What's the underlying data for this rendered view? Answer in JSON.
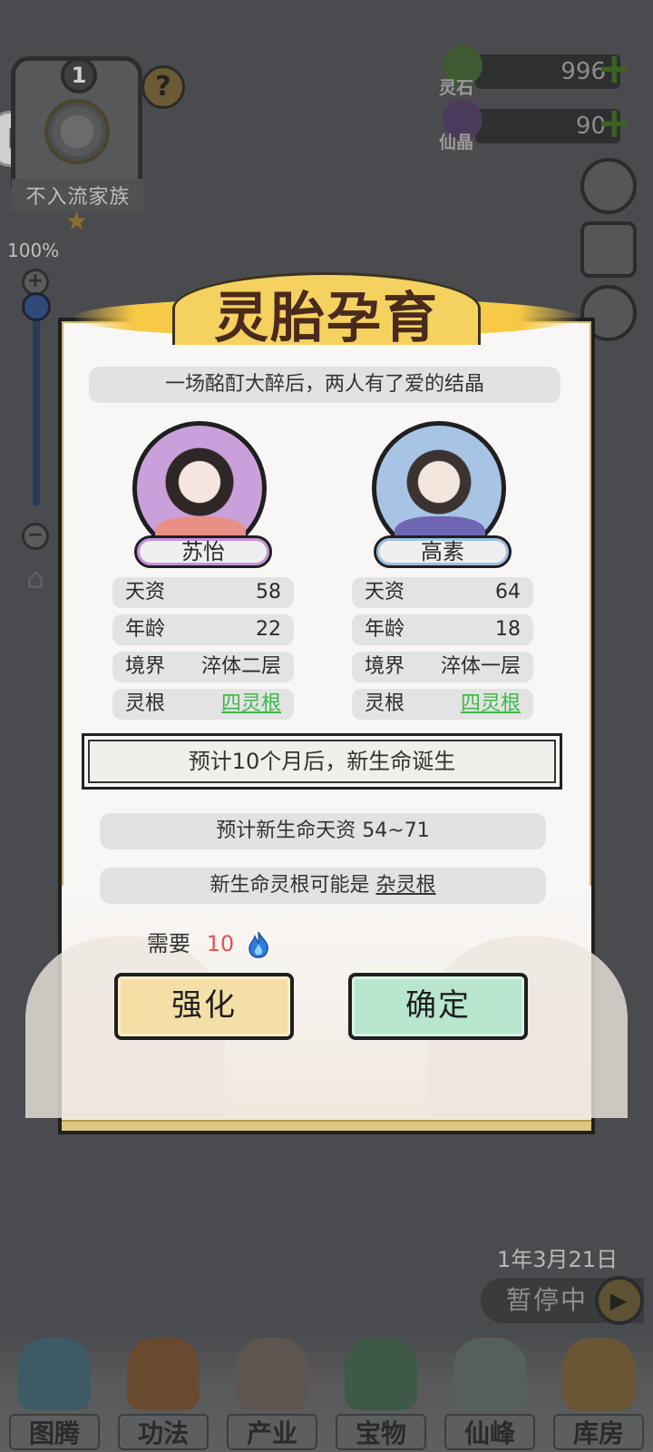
{
  "hud": {
    "clan_level": "1",
    "clan_name": "不入流家族",
    "help_label": "?",
    "resources": [
      {
        "label": "灵石",
        "value": "996",
        "plus": "+"
      },
      {
        "label": "仙晶",
        "value": "90",
        "plus": "+"
      }
    ],
    "zoom_percent": "100%",
    "zoom_in": "+",
    "zoom_out": "−",
    "game_date": "1年3月21日",
    "pause_label": "暂停中",
    "play_icon": "▶"
  },
  "bottom_nav": [
    {
      "label": "图腾",
      "icon": "totem-icon"
    },
    {
      "label": "功法",
      "icon": "flame-scroll-icon"
    },
    {
      "label": "产业",
      "icon": "mountain-house-icon"
    },
    {
      "label": "宝物",
      "icon": "treasure-seal-icon"
    },
    {
      "label": "仙峰",
      "icon": "peak-icon"
    },
    {
      "label": "库房",
      "icon": "bag-icon"
    }
  ],
  "modal": {
    "title": "灵胎孕育",
    "story": "一场酩酊大醉后，两人有了爱的结晶",
    "parents": [
      {
        "name": "苏怡",
        "stats": [
          {
            "label": "天资",
            "value": "58"
          },
          {
            "label": "年龄",
            "value": "22"
          },
          {
            "label": "境界",
            "value": "淬体二层"
          },
          {
            "label": "灵根",
            "value": "四灵根"
          }
        ]
      },
      {
        "name": "高素",
        "stats": [
          {
            "label": "天资",
            "value": "64"
          },
          {
            "label": "年龄",
            "value": "18"
          },
          {
            "label": "境界",
            "value": "淬体一层"
          },
          {
            "label": "灵根",
            "value": "四灵根"
          }
        ]
      }
    ],
    "prediction": "预计10个月后，新生命诞生",
    "aptitude_text": "预计新生命天资 54~71",
    "root_prefix": "新生命灵根可能是 ",
    "root_value": "杂灵根",
    "cost_label": "需要",
    "cost_value": "10",
    "enhance_label": "强化",
    "confirm_label": "确定"
  },
  "colors": {
    "link_green": "#3db84a",
    "cost_red": "#e05454",
    "banner_gold": "#f6c945",
    "enhance_bg": "#f4e0a7",
    "confirm_bg": "#b8e6cf"
  }
}
